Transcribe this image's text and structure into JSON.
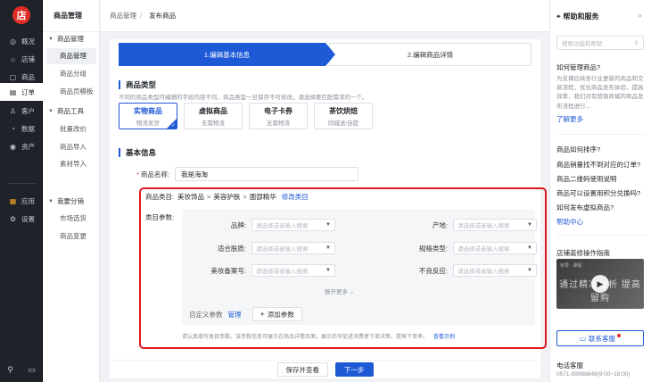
{
  "rail": {
    "logo": "店",
    "items": [
      {
        "label": "概况",
        "icon": "overview-icon",
        "glyph": "◎"
      },
      {
        "label": "店铺",
        "icon": "store-icon",
        "glyph": "⌂"
      },
      {
        "label": "商品",
        "icon": "goods-icon",
        "glyph": "▢"
      },
      {
        "label": "订单",
        "icon": "order-icon",
        "glyph": "▤"
      },
      {
        "label": "客户",
        "icon": "customer-icon",
        "glyph": "♙"
      },
      {
        "label": "数据",
        "icon": "data-icon",
        "glyph": "◔"
      },
      {
        "label": "资产",
        "icon": "asset-icon",
        "glyph": "◉"
      },
      {
        "label": "应用",
        "icon": "apps-icon",
        "glyph": "▦"
      },
      {
        "label": "设置",
        "icon": "settings-icon",
        "glyph": "⚙"
      }
    ],
    "bottom": {
      "search_glyph": "⚲",
      "msg_glyph": "▭"
    }
  },
  "sub": {
    "title": "商品管理",
    "groups": [
      {
        "label": "商品管理",
        "items": [
          "商品管理",
          "商品分组",
          "商品页模板"
        ]
      },
      {
        "label": "商品工具",
        "items": [
          "批量改价",
          "商品导入",
          "素材导入"
        ]
      },
      {
        "label": "我要分销",
        "items": [
          "市场选货",
          "商品变更"
        ]
      }
    ]
  },
  "breadcrumb": {
    "parent": "商品管理",
    "separator": "/",
    "current": "发布商品"
  },
  "steps": {
    "step1": "1.编辑基本信息",
    "step2": "2.编辑商品详情"
  },
  "product_type": {
    "title": "商品类型",
    "desc": "不同的商品类型可编辑的字段内容不同，商品类型一旦保存不可修改，请选择要匹配需求的一个。",
    "options": [
      {
        "name": "实物商品",
        "sub": "物流发货",
        "selected": true
      },
      {
        "name": "虚拟商品",
        "sub": "无需物流",
        "selected": false
      },
      {
        "name": "电子卡券",
        "sub": "无需物流",
        "selected": false
      },
      {
        "name": "茶饮烘焙",
        "sub": "同城送/自提",
        "selected": false
      }
    ]
  },
  "basic": {
    "title": "基本信息",
    "name_label": "商品名称:",
    "name_value": "我是海淘",
    "category_label": "商品类目:",
    "category_path": [
      "美妆饰品",
      "美容护肤",
      "面部精华"
    ],
    "category_sep": ">",
    "edit_category": "修改类目",
    "params_label": "类目参数:",
    "params": [
      {
        "label": "品牌:",
        "placeholder": "请选择或者输入搜索"
      },
      {
        "label": "产地:",
        "placeholder": "请选择或者输入搜索"
      },
      {
        "label": "适合肤质:",
        "placeholder": "请选择或者输入搜索"
      },
      {
        "label": "规格类型:",
        "placeholder": "请选择或者输入搜索"
      },
      {
        "label": "美妆备案号:",
        "placeholder": "请选择或者输入搜索"
      },
      {
        "label": "不良反应:",
        "placeholder": "请选择或者输入搜索"
      }
    ],
    "expand_more": "展开更多",
    "custom_params": "自定义参数",
    "manage": "管理",
    "add_param": "添加参数",
    "hint": "请认真填写类目参数。该参数信息可展示在商品详情页面，展示后可促进消费者下单决策，提高下单率。",
    "view_example": "查看示例"
  },
  "actions": {
    "save_view": "保存并查看",
    "next": "下一步"
  },
  "help": {
    "title": "帮助和服务",
    "search_placeholder": "搜索功能和帮助",
    "q1": "如何管理商品?",
    "q1_text": "为支撑后续各行业更新的商品和交易流程，优化商品发布体验，提高效率，我们对有赞微商城的商品发布流程进行...",
    "learn_more": "了解更多",
    "faqs": [
      "商品如何排序?",
      "商品销量找不到对应的订单?",
      "商品二维码使用说明",
      "商品可以设置用积分兑换吗?",
      "如何发布虚拟商品?"
    ],
    "help_center": "帮助中心",
    "guide_title": "店铺装修操作指南",
    "video_text": "通过精准分析 提高留购",
    "video_small": "有赞 · 课程",
    "cs_button": "联系客服",
    "phone_label": "电话客服",
    "phone": "0571-89988848(9:00~18:00)"
  },
  "colors": {
    "primary": "#1e5ad6",
    "highlight": "#e0161d",
    "rail": "#1f2329"
  }
}
